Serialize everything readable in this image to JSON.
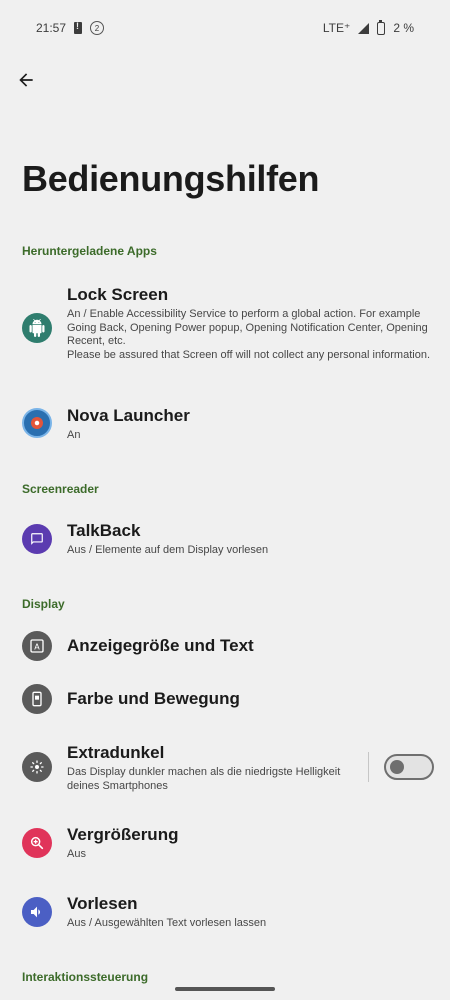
{
  "status": {
    "time": "21:57",
    "notif_count": "2",
    "network": "LTE⁺",
    "battery": "2 %"
  },
  "page": {
    "title": "Bedienungshilfen"
  },
  "sections": {
    "downloaded": "Heruntergeladene Apps",
    "screenreader": "Screenreader",
    "display": "Display",
    "interaction": "Interaktionssteuerung"
  },
  "items": {
    "lock_screen": {
      "title": "Lock Screen",
      "subtitle_1": "An / Enable Accessibility Service to perform a global action. For example Going Back, Opening Power popup, Opening Notification Center, Opening Recent, etc.",
      "subtitle_2": "Please be assured that Screen off will not collect any personal information."
    },
    "nova": {
      "title": "Nova Launcher",
      "subtitle": "An"
    },
    "talkback": {
      "title": "TalkBack",
      "subtitle": "Aus / Elemente auf dem Display vorlesen"
    },
    "display_size": {
      "title": "Anzeigegröße und Text"
    },
    "color_motion": {
      "title": "Farbe und Bewegung"
    },
    "extra_dim": {
      "title": "Extradunkel",
      "subtitle": "Das Display dunkler machen als die niedrigste Helligkeit deines Smartphones",
      "enabled": false
    },
    "magnification": {
      "title": "Vergrößerung",
      "subtitle": "Aus"
    },
    "select_to_speak": {
      "title": "Vorlesen",
      "subtitle": "Aus / Ausgewählten Text vorlesen lassen"
    }
  },
  "colors": {
    "section_header": "#3c6b2a",
    "lock_icon_bg": "#2f7d6e",
    "talkback_icon_bg": "#5b3bb0",
    "gray_icon_bg": "#5a5a5a",
    "magnify_icon_bg": "#e0345a",
    "speak_icon_bg": "#4b5fc4"
  }
}
